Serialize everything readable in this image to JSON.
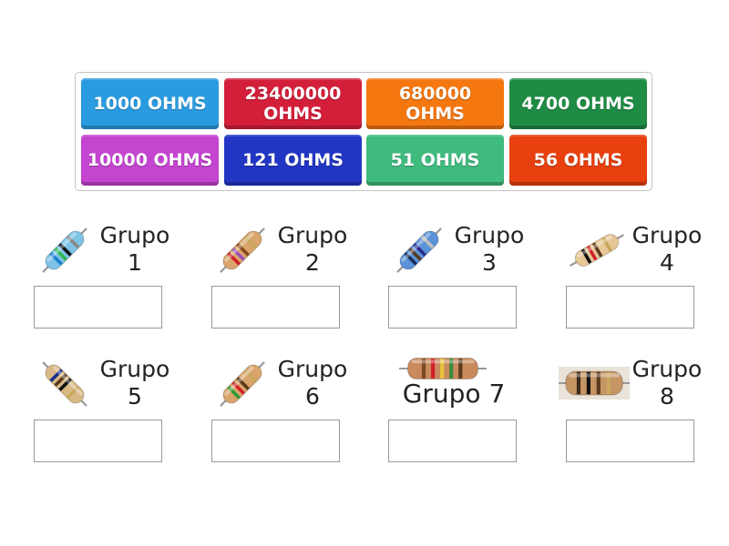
{
  "tiles": [
    {
      "label": "1000 OHMS",
      "color": "#2a9be0"
    },
    {
      "label": "23400000 OHMS",
      "color": "#d41f3a"
    },
    {
      "label": "680000 OHMS",
      "color": "#f47710"
    },
    {
      "label": "4700 OHMS",
      "color": "#1f8c45"
    },
    {
      "label": "10000 OHMS",
      "color": "#c445d0"
    },
    {
      "label": "121 OHMS",
      "color": "#2236c4"
    },
    {
      "label": "51 OHMS",
      "color": "#3fbb7e"
    },
    {
      "label": "56 OHMS",
      "color": "#e8400f"
    }
  ],
  "groups": [
    {
      "word": "Grupo",
      "number": "1",
      "resistor_bands": [
        "#1a7fd0",
        "#2eb84a",
        "#111111",
        "#888888"
      ],
      "body_color": "#7ec3e6",
      "image": "tilted-resistor"
    },
    {
      "word": "Grupo",
      "number": "2",
      "resistor_bands": [
        "#d11f2a",
        "#9c4fb8",
        "#8a4a1c",
        "#c9a75c"
      ],
      "body_color": "#d9a56b",
      "image": "tilted-resistor"
    },
    {
      "word": "Grupo",
      "number": "3",
      "resistor_bands": [
        "#1b2f5c",
        "#5a3a1e",
        "#2a2a8a",
        "#c0c0c0"
      ],
      "body_color": "#5b92d8",
      "image": "tilted-resistor"
    },
    {
      "word": "Grupo",
      "number": "4",
      "resistor_bands": [
        "#111111",
        "#d11f2a",
        "#5a3a1e",
        "#c9a75c"
      ],
      "body_color": "#e7c796",
      "image": "tilted-resistor"
    },
    {
      "word": "Grupo",
      "number": "5",
      "resistor_bands": [
        "#1b2f8c",
        "#5a3a1e",
        "#111111",
        "#c9a75c"
      ],
      "body_color": "#d8b985",
      "image": "tilted-resistor"
    },
    {
      "word": "Grupo",
      "number": "6",
      "resistor_bands": [
        "#2c9a3a",
        "#d11f2a",
        "#5a3a1e",
        "#c9a75c"
      ],
      "body_color": "#d9a56b",
      "image": "tilted-resistor"
    },
    {
      "word": "Grupo 7",
      "number": "",
      "resistor_bands": [
        "#7a4a22",
        "#d11f2a",
        "#e8c33a",
        "#3a8a3a",
        "#5a3a1e"
      ],
      "body_color": "#c98a5e",
      "image": "flat-resistor"
    },
    {
      "word": "Grupo",
      "number": "8",
      "resistor_bands": [
        "#3a2a1a",
        "#111111",
        "#5a3a1e",
        "#c9a75c"
      ],
      "body_color": "#c59564",
      "image": "flat-resistor-photo"
    }
  ]
}
